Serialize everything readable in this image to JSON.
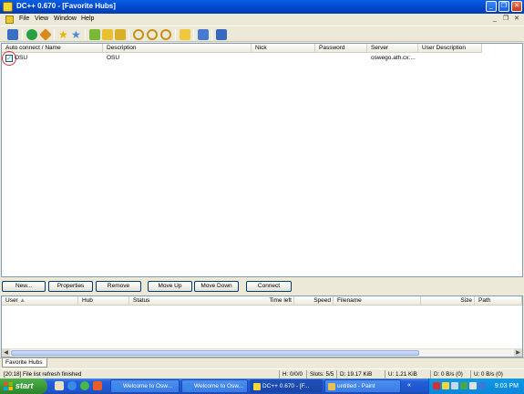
{
  "window": {
    "title": "DC++ 0.670 - [Favorite Hubs]"
  },
  "menu": [
    "File",
    "View",
    "Window",
    "Help"
  ],
  "toolbar_icons": [
    "public-hubs-icon",
    "reconnect-icon",
    "follow-redirect-icon",
    "favorite-hubs-icon",
    "favorite-users-icon",
    "download-queue-icon",
    "finished-downloads-icon",
    "upload-queue-icon",
    "search-icon",
    "adl-search-icon",
    "search-spy-icon",
    "open-file-list-icon",
    "settings-icon",
    "notepad-icon"
  ],
  "favorites": {
    "columns": [
      "Auto connect / Name",
      "Description",
      "Nick",
      "Password",
      "Server",
      "User Description"
    ],
    "rows": [
      {
        "checked": true,
        "name": "OSU",
        "description": "OSU",
        "nick": "",
        "password": "",
        "server": "oswego.ath.cx:...",
        "user_description": ""
      }
    ]
  },
  "buttons": {
    "new": "New...",
    "properties": "Properties",
    "remove": "Remove",
    "move_up": "Move Up",
    "move_down": "Move Down",
    "connect": "Connect"
  },
  "transfers": {
    "columns": [
      "User",
      "Hub",
      "Status",
      "Time left",
      "Speed",
      "Filename",
      "Size",
      "Path"
    ]
  },
  "tabs": [
    "Favorite Hubs"
  ],
  "status": {
    "message": "[20:18] File list refresh finished",
    "hubs": "H: 0/0/0",
    "slots": "Slots: 5/5",
    "downloaded": "D: 19.17 KiB",
    "uploaded": "U: 1.21 KiB",
    "down_speed": "D: 0 B/s (0)",
    "up_speed": "U: 0 B/s (0)"
  },
  "taskbar": {
    "start": "start",
    "tasks": [
      "Welcome to Osw...",
      "Welcome to Osw...",
      "DC++ 0.670 - [F...",
      "untitled - Paint"
    ],
    "clock": "9:03 PM"
  },
  "colors": {
    "title_bar": "#0a5ee4",
    "taskbar": "#245edb",
    "start_button": "#3a9a3a",
    "check": "#21a121",
    "highlight_circle": "#e03030"
  }
}
